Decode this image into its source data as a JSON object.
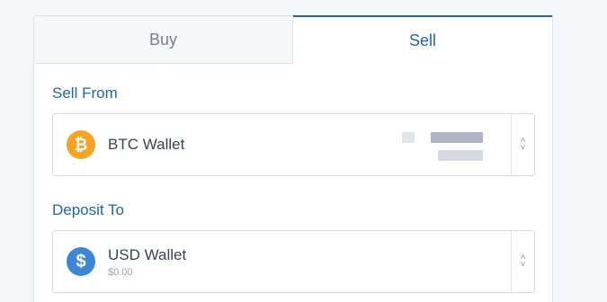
{
  "tabs": {
    "buy_label": "Buy",
    "sell_label": "Sell",
    "active": "Sell"
  },
  "sell_from": {
    "label": "Sell From",
    "wallet_name": "BTC Wallet",
    "icon": "bitcoin-icon"
  },
  "deposit_to": {
    "label": "Deposit To",
    "wallet_name": "USD Wallet",
    "balance": "$0.00",
    "icon": "dollar-icon"
  },
  "colors": {
    "accent": "#1f64b0",
    "btc": "#f7a328",
    "usd": "#3d86d6"
  }
}
